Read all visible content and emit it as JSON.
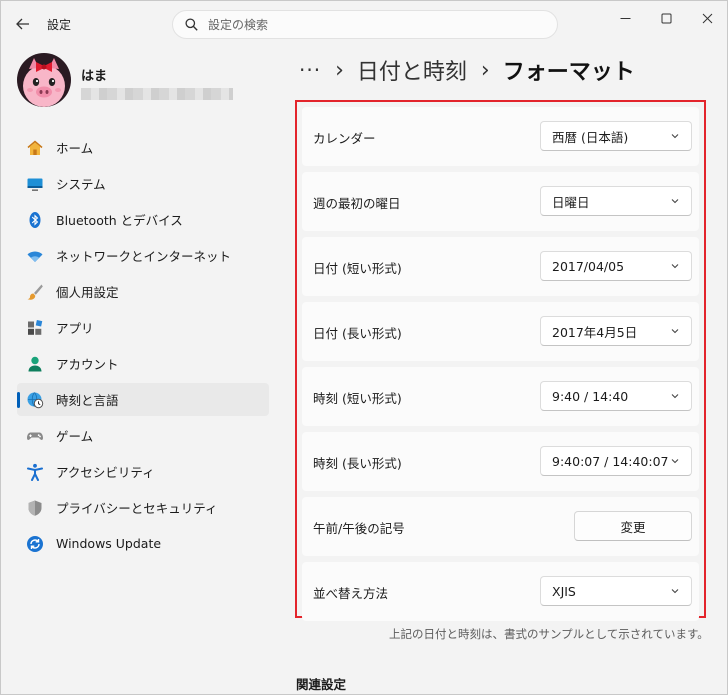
{
  "window": {
    "app_title": "設定",
    "controls": {
      "minimize": "—",
      "maximize": "☐",
      "close": "✕"
    }
  },
  "search": {
    "placeholder": "設定の検索"
  },
  "profile": {
    "name": "はま"
  },
  "sidebar": {
    "items": [
      {
        "label": "ホーム",
        "icon": "home-icon"
      },
      {
        "label": "システム",
        "icon": "system-icon"
      },
      {
        "label": "Bluetooth とデバイス",
        "icon": "bluetooth-icon"
      },
      {
        "label": "ネットワークとインターネット",
        "icon": "wifi-icon"
      },
      {
        "label": "個人用設定",
        "icon": "brush-icon"
      },
      {
        "label": "アプリ",
        "icon": "apps-icon"
      },
      {
        "label": "アカウント",
        "icon": "account-icon"
      },
      {
        "label": "時刻と言語",
        "icon": "time-language-icon",
        "active": true
      },
      {
        "label": "ゲーム",
        "icon": "gamepad-icon"
      },
      {
        "label": "アクセシビリティ",
        "icon": "accessibility-icon"
      },
      {
        "label": "プライバシーとセキュリティ",
        "icon": "shield-icon"
      },
      {
        "label": "Windows Update",
        "icon": "update-icon"
      }
    ]
  },
  "breadcrumb": {
    "more": "···",
    "sep": "›",
    "parent": "日付と時刻",
    "current": "フォーマット"
  },
  "format_settings": [
    {
      "label": "カレンダー",
      "value": "西暦 (日本語)",
      "control": "dropdown"
    },
    {
      "label": "週の最初の曜日",
      "value": "日曜日",
      "control": "dropdown"
    },
    {
      "label": "日付 (短い形式)",
      "value": "2017/04/05",
      "control": "dropdown"
    },
    {
      "label": "日付 (長い形式)",
      "value": "2017年4月5日",
      "control": "dropdown"
    },
    {
      "label": "時刻 (短い形式)",
      "value": "9:40 / 14:40",
      "control": "dropdown"
    },
    {
      "label": "時刻 (長い形式)",
      "value": "9:40:07 / 14:40:07",
      "control": "dropdown"
    },
    {
      "label": "午前/午後の記号",
      "value": "変更",
      "control": "button"
    },
    {
      "label": "並べ替え方法",
      "value": "XJIS",
      "control": "dropdown"
    }
  ],
  "sample_note": "上記の日付と時刻は、書式のサンプルとして示されています。",
  "related": {
    "title": "関連設定"
  },
  "colors": {
    "accent": "#005fb8",
    "highlight_border": "#e3242b",
    "background": "#f3f3f3",
    "card": "#fbfbfb"
  }
}
